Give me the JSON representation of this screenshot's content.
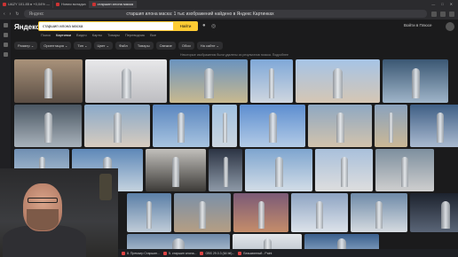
{
  "tabs": [
    {
      "label": "UAZY 101.85 в +0,04% —"
    },
    {
      "label": "Новая вкладка"
    },
    {
      "label": "старшип илона маска"
    }
  ],
  "window_controls": [
    "—",
    "□",
    "✕"
  ],
  "address": {
    "icon_label": "Яндекс",
    "title": "старшип илона маска: 1 тыс изображений найдено в Яндекс Картинках"
  },
  "header": {
    "logo": "Яндекс",
    "query": "старшип илона маска",
    "clear": "×",
    "find_label": "Найти",
    "login_label": "Войти в Плюсе"
  },
  "nav_tabs": [
    "Поиск",
    "Картинки",
    "Видео",
    "Карты",
    "Товары",
    "Переводчик",
    "Все"
  ],
  "active_tab": "Картинки",
  "filters": [
    "Размер",
    "Ориентация",
    "Тип",
    "Цвет",
    "Файл",
    "Товары",
    "Свежие",
    "Обои",
    "На сайте"
  ],
  "notice": "Некоторые изображения были удалены из результатов поиска. Подробнее",
  "images": [
    {
      "name": "img-r1-1",
      "c1": "#a9927a",
      "c2": "#5b4e44"
    },
    {
      "name": "img-r1-2",
      "c1": "#e8e8ea",
      "c2": "#bdbdc1"
    },
    {
      "name": "img-r1-3",
      "c1": "#6a93bf",
      "c2": "#c9b98f"
    },
    {
      "name": "img-r1-4",
      "c1": "#7fa8d8",
      "c2": "#cfd6df"
    },
    {
      "name": "img-r1-5",
      "c1": "#a6c4e6",
      "c2": "#d5c6b4"
    },
    {
      "name": "img-r1-6",
      "c1": "#3b5773",
      "c2": "#9fb5c9"
    },
    {
      "name": "img-r2-1",
      "c1": "#4a5662",
      "c2": "#a8b2bb"
    },
    {
      "name": "img-r2-2",
      "c1": "#8aa9c9",
      "c2": "#d7ccbf"
    },
    {
      "name": "img-r2-3",
      "c1": "#5a86bf",
      "c2": "#a8c4e0"
    },
    {
      "name": "img-r2-4",
      "c1": "#9fc0e0",
      "c2": "#ccd6e0"
    },
    {
      "name": "img-r2-5",
      "c1": "#5d8ed0",
      "c2": "#b3cbe6"
    },
    {
      "name": "img-r2-6",
      "c1": "#8fa8c2",
      "c2": "#d2c3ad"
    },
    {
      "name": "img-r2-7",
      "c1": "#8aa2bd",
      "c2": "#cbb896"
    },
    {
      "name": "img-r2-8",
      "c1": "#3f5f85",
      "c2": "#aabad0"
    },
    {
      "name": "img-r3-1",
      "c1": "#6f8fb2",
      "c2": "#c7d4e1"
    },
    {
      "name": "img-r3-2",
      "c1": "#5e88b8",
      "c2": "#c5d3df"
    },
    {
      "name": "img-r3-3",
      "c1": "#c2c0bc",
      "c2": "#3d3b38"
    },
    {
      "name": "img-r3-4",
      "c1": "#2c3444",
      "c2": "#8e9aa8"
    },
    {
      "name": "img-r3-5",
      "c1": "#7ea5cf",
      "c2": "#d3dde7"
    },
    {
      "name": "img-r3-6",
      "c1": "#a9c0db",
      "c2": "#dedede"
    },
    {
      "name": "img-r3-7",
      "c1": "#7d8f9e",
      "c2": "#cfcfcf"
    },
    {
      "name": "img-r4-1",
      "c1": "#5b7fa7",
      "c2": "#c0ccd8"
    },
    {
      "name": "img-r4-2",
      "c1": "#7b90a8",
      "c2": "#b59e83"
    },
    {
      "name": "img-r4-3",
      "c1": "#7b5a77",
      "c2": "#c58d6a"
    },
    {
      "name": "img-r4-4",
      "c1": "#8ea4c3",
      "c2": "#dde3ea"
    },
    {
      "name": "img-r4-5",
      "c1": "#6e8aa8",
      "c2": "#d6dbe0"
    },
    {
      "name": "img-r4-6",
      "c1": "#1d232e",
      "c2": "#5a6577"
    },
    {
      "name": "img-r5-1",
      "c1": "#c88a4d",
      "c2": "#e3b27a"
    },
    {
      "name": "img-r5-2",
      "c1": "#6d88a8",
      "c2": "#c1cfdb"
    },
    {
      "name": "img-r5-3",
      "c1": "#e3e6ea",
      "c2": "#b3bcc6"
    },
    {
      "name": "img-r5-4",
      "c1": "#3a5f8c",
      "c2": "#9bb4d1"
    }
  ],
  "taskbar": [
    {
      "label": "8. Премьер Старшип..."
    },
    {
      "label": "5. старшип илона..."
    },
    {
      "label": "OBS 29.0.3 (64 bit)..."
    },
    {
      "label": "Безымянный - Paint"
    }
  ]
}
